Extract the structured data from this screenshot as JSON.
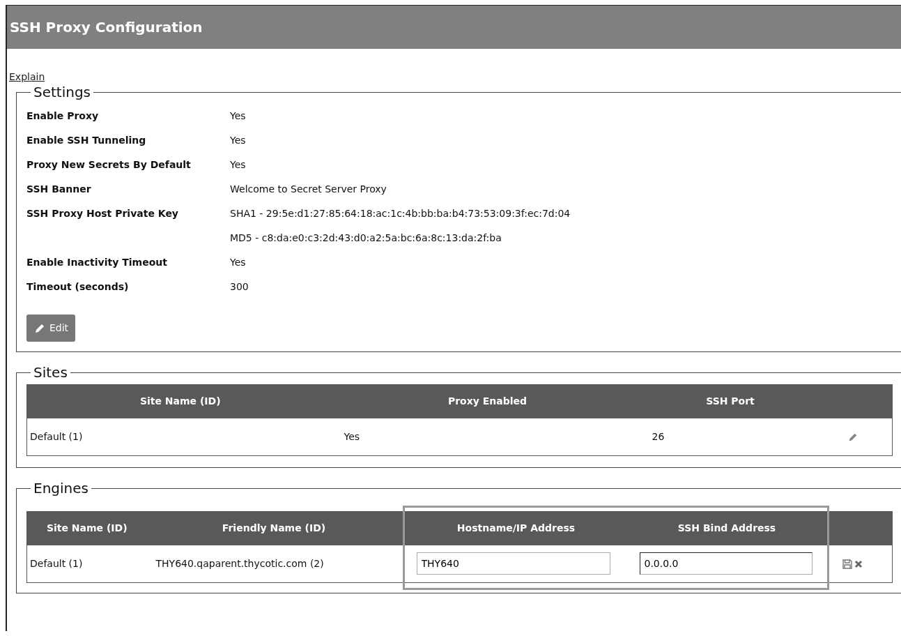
{
  "title": "SSH Proxy Configuration",
  "explain_link": "Explain",
  "settings": {
    "legend": "Settings",
    "rows": [
      {
        "label": "Enable Proxy",
        "values": [
          "Yes"
        ]
      },
      {
        "label": "Enable SSH Tunneling",
        "values": [
          "Yes"
        ]
      },
      {
        "label": "Proxy New Secrets By Default",
        "values": [
          "Yes"
        ]
      },
      {
        "label": "SSH Banner",
        "values": [
          "Welcome to Secret Server Proxy"
        ]
      },
      {
        "label": "SSH Proxy Host Private Key",
        "values": [
          "SHA1 - 29:5e:d1:27:85:64:18:ac:1c:4b:bb:ba:b4:73:53:09:3f:ec:7d:04",
          "MD5 - c8:da:e0:c3:2d:43:d0:a2:5a:bc:6a:8c:13:da:2f:ba"
        ]
      },
      {
        "label": "Enable Inactivity Timeout",
        "values": [
          "Yes"
        ]
      },
      {
        "label": "Timeout (seconds)",
        "values": [
          "300"
        ]
      }
    ],
    "edit_button": "Edit"
  },
  "sites": {
    "legend": "Sites",
    "columns": [
      "Site Name (ID)",
      "Proxy Enabled",
      "SSH Port"
    ],
    "rows": [
      {
        "cells": [
          "Default (1)",
          "Yes",
          "26"
        ]
      }
    ]
  },
  "engines": {
    "legend": "Engines",
    "columns": [
      "Site Name (ID)",
      "Friendly Name (ID)",
      "Hostname/IP Address",
      "SSH Bind Address"
    ],
    "rows": [
      {
        "cells": [
          "Default (1)",
          "THY640.qaparent.thycotic.com (2)"
        ],
        "fields": [
          "THY640",
          "0.0.0.0"
        ]
      }
    ]
  }
}
